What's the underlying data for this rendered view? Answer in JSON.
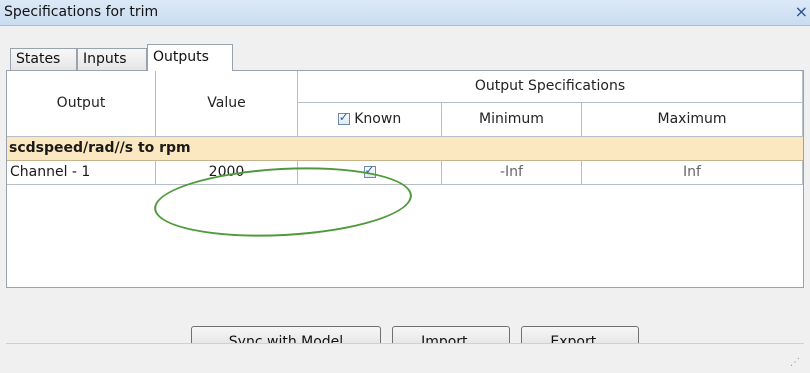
{
  "window": {
    "title": "Specifications for trim",
    "close_glyph": "×"
  },
  "tabs": [
    {
      "label": "States",
      "active": false
    },
    {
      "label": "Inputs",
      "active": false
    },
    {
      "label": "Outputs",
      "active": true
    }
  ],
  "table": {
    "headers": {
      "output": "Output",
      "value": "Value",
      "group": "Output Specifications",
      "known": "Known",
      "minimum": "Minimum",
      "maximum": "Maximum"
    },
    "known_header_checked": true,
    "group_label": "scdspeed/rad//s to rpm",
    "rows": [
      {
        "output": "Channel - 1",
        "value": "2000",
        "known": true,
        "minimum": "-Inf",
        "maximum": "Inf"
      }
    ]
  },
  "buttons": {
    "sync": "Sync with Model",
    "import": "Import...",
    "export": "Export..."
  },
  "annotation": {
    "color": "#4e9a3a",
    "shape": "ellipse"
  },
  "colors": {
    "group_row_bg": "#fbe8c0",
    "title_bar": "#c9dcf1"
  },
  "icons": {
    "check": "✓",
    "resize_grip": "⋰"
  }
}
